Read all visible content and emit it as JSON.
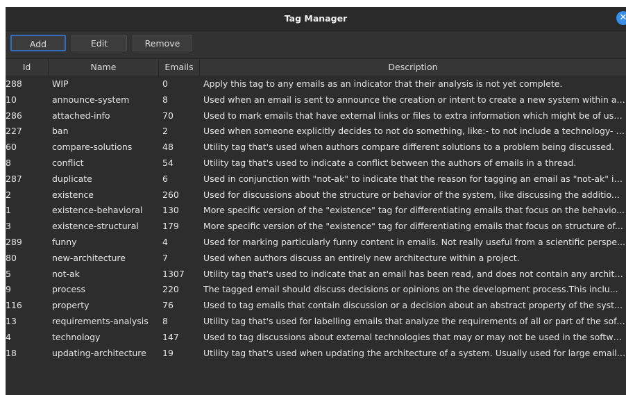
{
  "window": {
    "title": "Tag Manager"
  },
  "toolbar": {
    "add_label": "Add",
    "edit_label": "Edit",
    "remove_label": "Remove"
  },
  "table": {
    "headers": {
      "id": "Id",
      "name": "Name",
      "emails": "Emails",
      "description": "Description"
    },
    "rows": [
      {
        "id": "288",
        "name": "WIP",
        "emails": "0",
        "description": "Apply this tag to any emails as an indicator that their analysis is not yet complete."
      },
      {
        "id": "10",
        "name": "announce-system",
        "emails": "8",
        "description": "Used when an email is sent to announce the creation or intent to create a new system within a ..."
      },
      {
        "id": "286",
        "name": "attached-info",
        "emails": "70",
        "description": "Used to mark emails that have external links or files to extra information which might be of use..."
      },
      {
        "id": "227",
        "name": "ban",
        "emails": "2",
        "description": "Used when someone explicitly decides to not do something, like:- to not include a technology- t..."
      },
      {
        "id": "60",
        "name": "compare-solutions",
        "emails": "48",
        "description": "Utility tag that's used when authors compare different solutions to a problem being discussed."
      },
      {
        "id": "8",
        "name": "conflict",
        "emails": "54",
        "description": "Utility tag that's used to indicate a conflict between the authors of emails in a thread."
      },
      {
        "id": "287",
        "name": "duplicate",
        "emails": "6",
        "description": "Used in conjunction with \"not-ak\" to indicate that the reason for tagging an email as \"not-ak\" is ..."
      },
      {
        "id": "2",
        "name": "existence",
        "emails": "260",
        "description": "Used for discussions about the structure or behavior of the system, like discussing the additio..."
      },
      {
        "id": "1",
        "name": "existence-behavioral",
        "emails": "130",
        "description": "More specific version of the \"existence\" tag for differentiating emails that focus on the behavio..."
      },
      {
        "id": "3",
        "name": "existence-structural",
        "emails": "179",
        "description": "More specific version of the \"existence\" tag for differentiating emails that focus on structure of..."
      },
      {
        "id": "289",
        "name": "funny",
        "emails": "4",
        "description": "Used for marking particularly funny content in emails. Not really useful from a scientific perspe..."
      },
      {
        "id": "80",
        "name": "new-architecture",
        "emails": "7",
        "description": "Used when authors discuss an entirely new architecture within a project."
      },
      {
        "id": "5",
        "name": "not-ak",
        "emails": "1307",
        "description": "Utility tag that's used to indicate that an email has been read, and does not contain any architec..."
      },
      {
        "id": "9",
        "name": "process",
        "emails": "220",
        "description": "The tagged email should discuss decisions or opinions on the development process.This inclu..."
      },
      {
        "id": "116",
        "name": "property",
        "emails": "76",
        "description": "Used to tag emails that contain discussion or a decision about an abstract property of the syst..."
      },
      {
        "id": "13",
        "name": "requirements-analysis",
        "emails": "8",
        "description": "Utility tag that's used for labelling emails that analyze the requirements of all or part of the soft..."
      },
      {
        "id": "4",
        "name": "technology",
        "emails": "147",
        "description": "Used to tag discussions about external technologies that may or may not be used in the softwa..."
      },
      {
        "id": "18",
        "name": "updating-architecture",
        "emails": "19",
        "description": "Utility tag that's used when updating the architecture of a system. Usually used for large emails..."
      }
    ]
  }
}
